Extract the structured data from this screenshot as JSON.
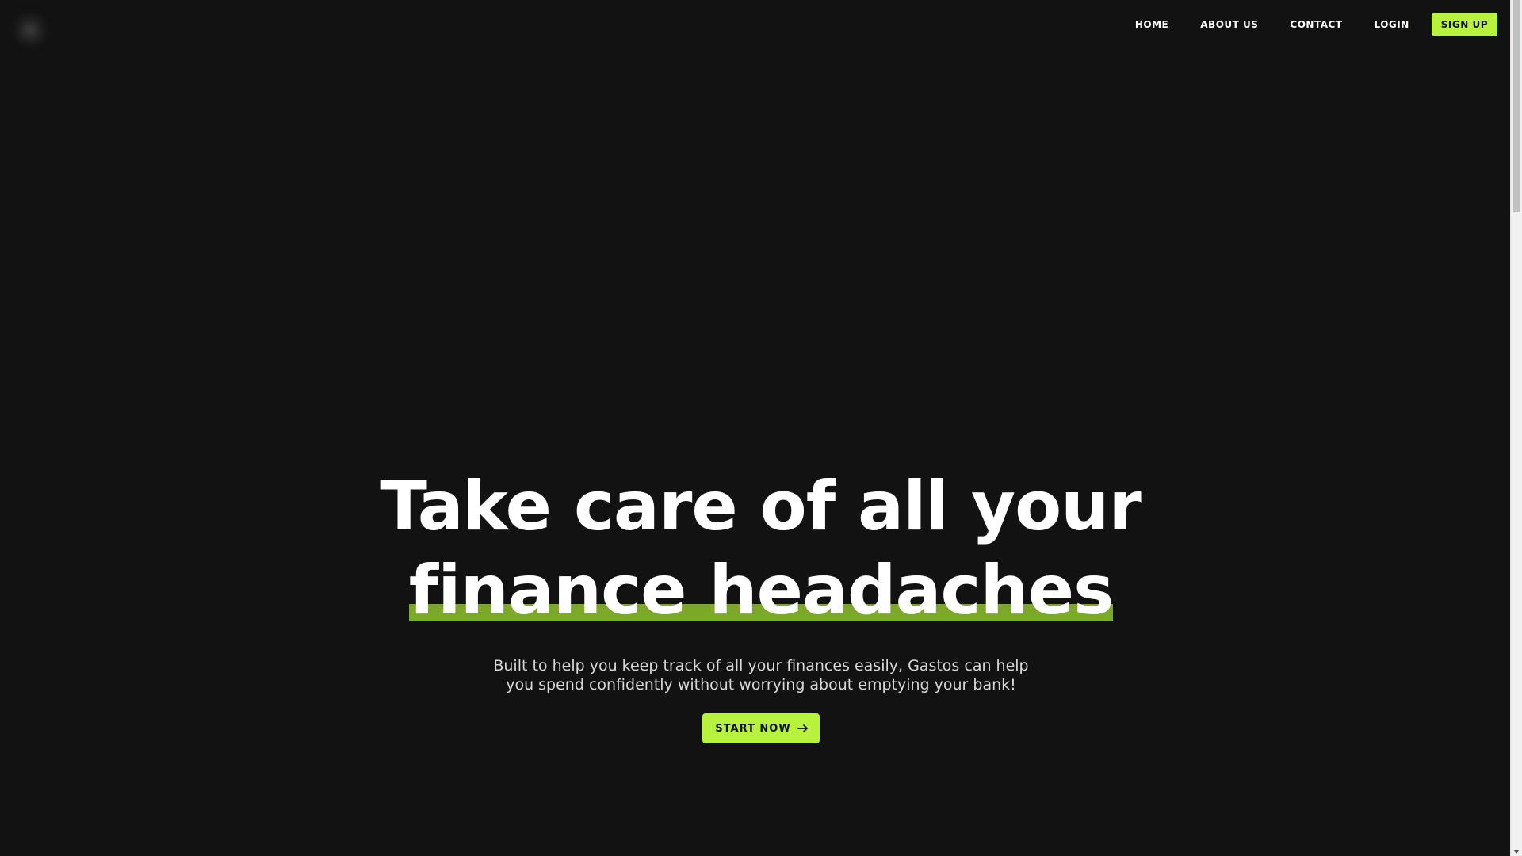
{
  "brand": {
    "logo_icon": "blurred-circle-logo"
  },
  "nav": {
    "items": [
      {
        "label": "HOME"
      },
      {
        "label": "ABOUT US"
      },
      {
        "label": "CONTACT"
      },
      {
        "label": "LOGIN"
      }
    ],
    "signup_label": "SIGN UP"
  },
  "hero": {
    "headline_line1": "Take care of all your",
    "headline_line2": "finance headaches",
    "subtitle_line1": "Built to help you keep track of all your finances easily, Gastos can help",
    "subtitle_line2": "you spend confidently without worrying about emptying your bank!",
    "cta_label": "START NOW",
    "cta_icon": "arrow-right-icon"
  },
  "colors": {
    "background": "#121212",
    "accent": "#b6f23e",
    "text": "#ffffff"
  }
}
